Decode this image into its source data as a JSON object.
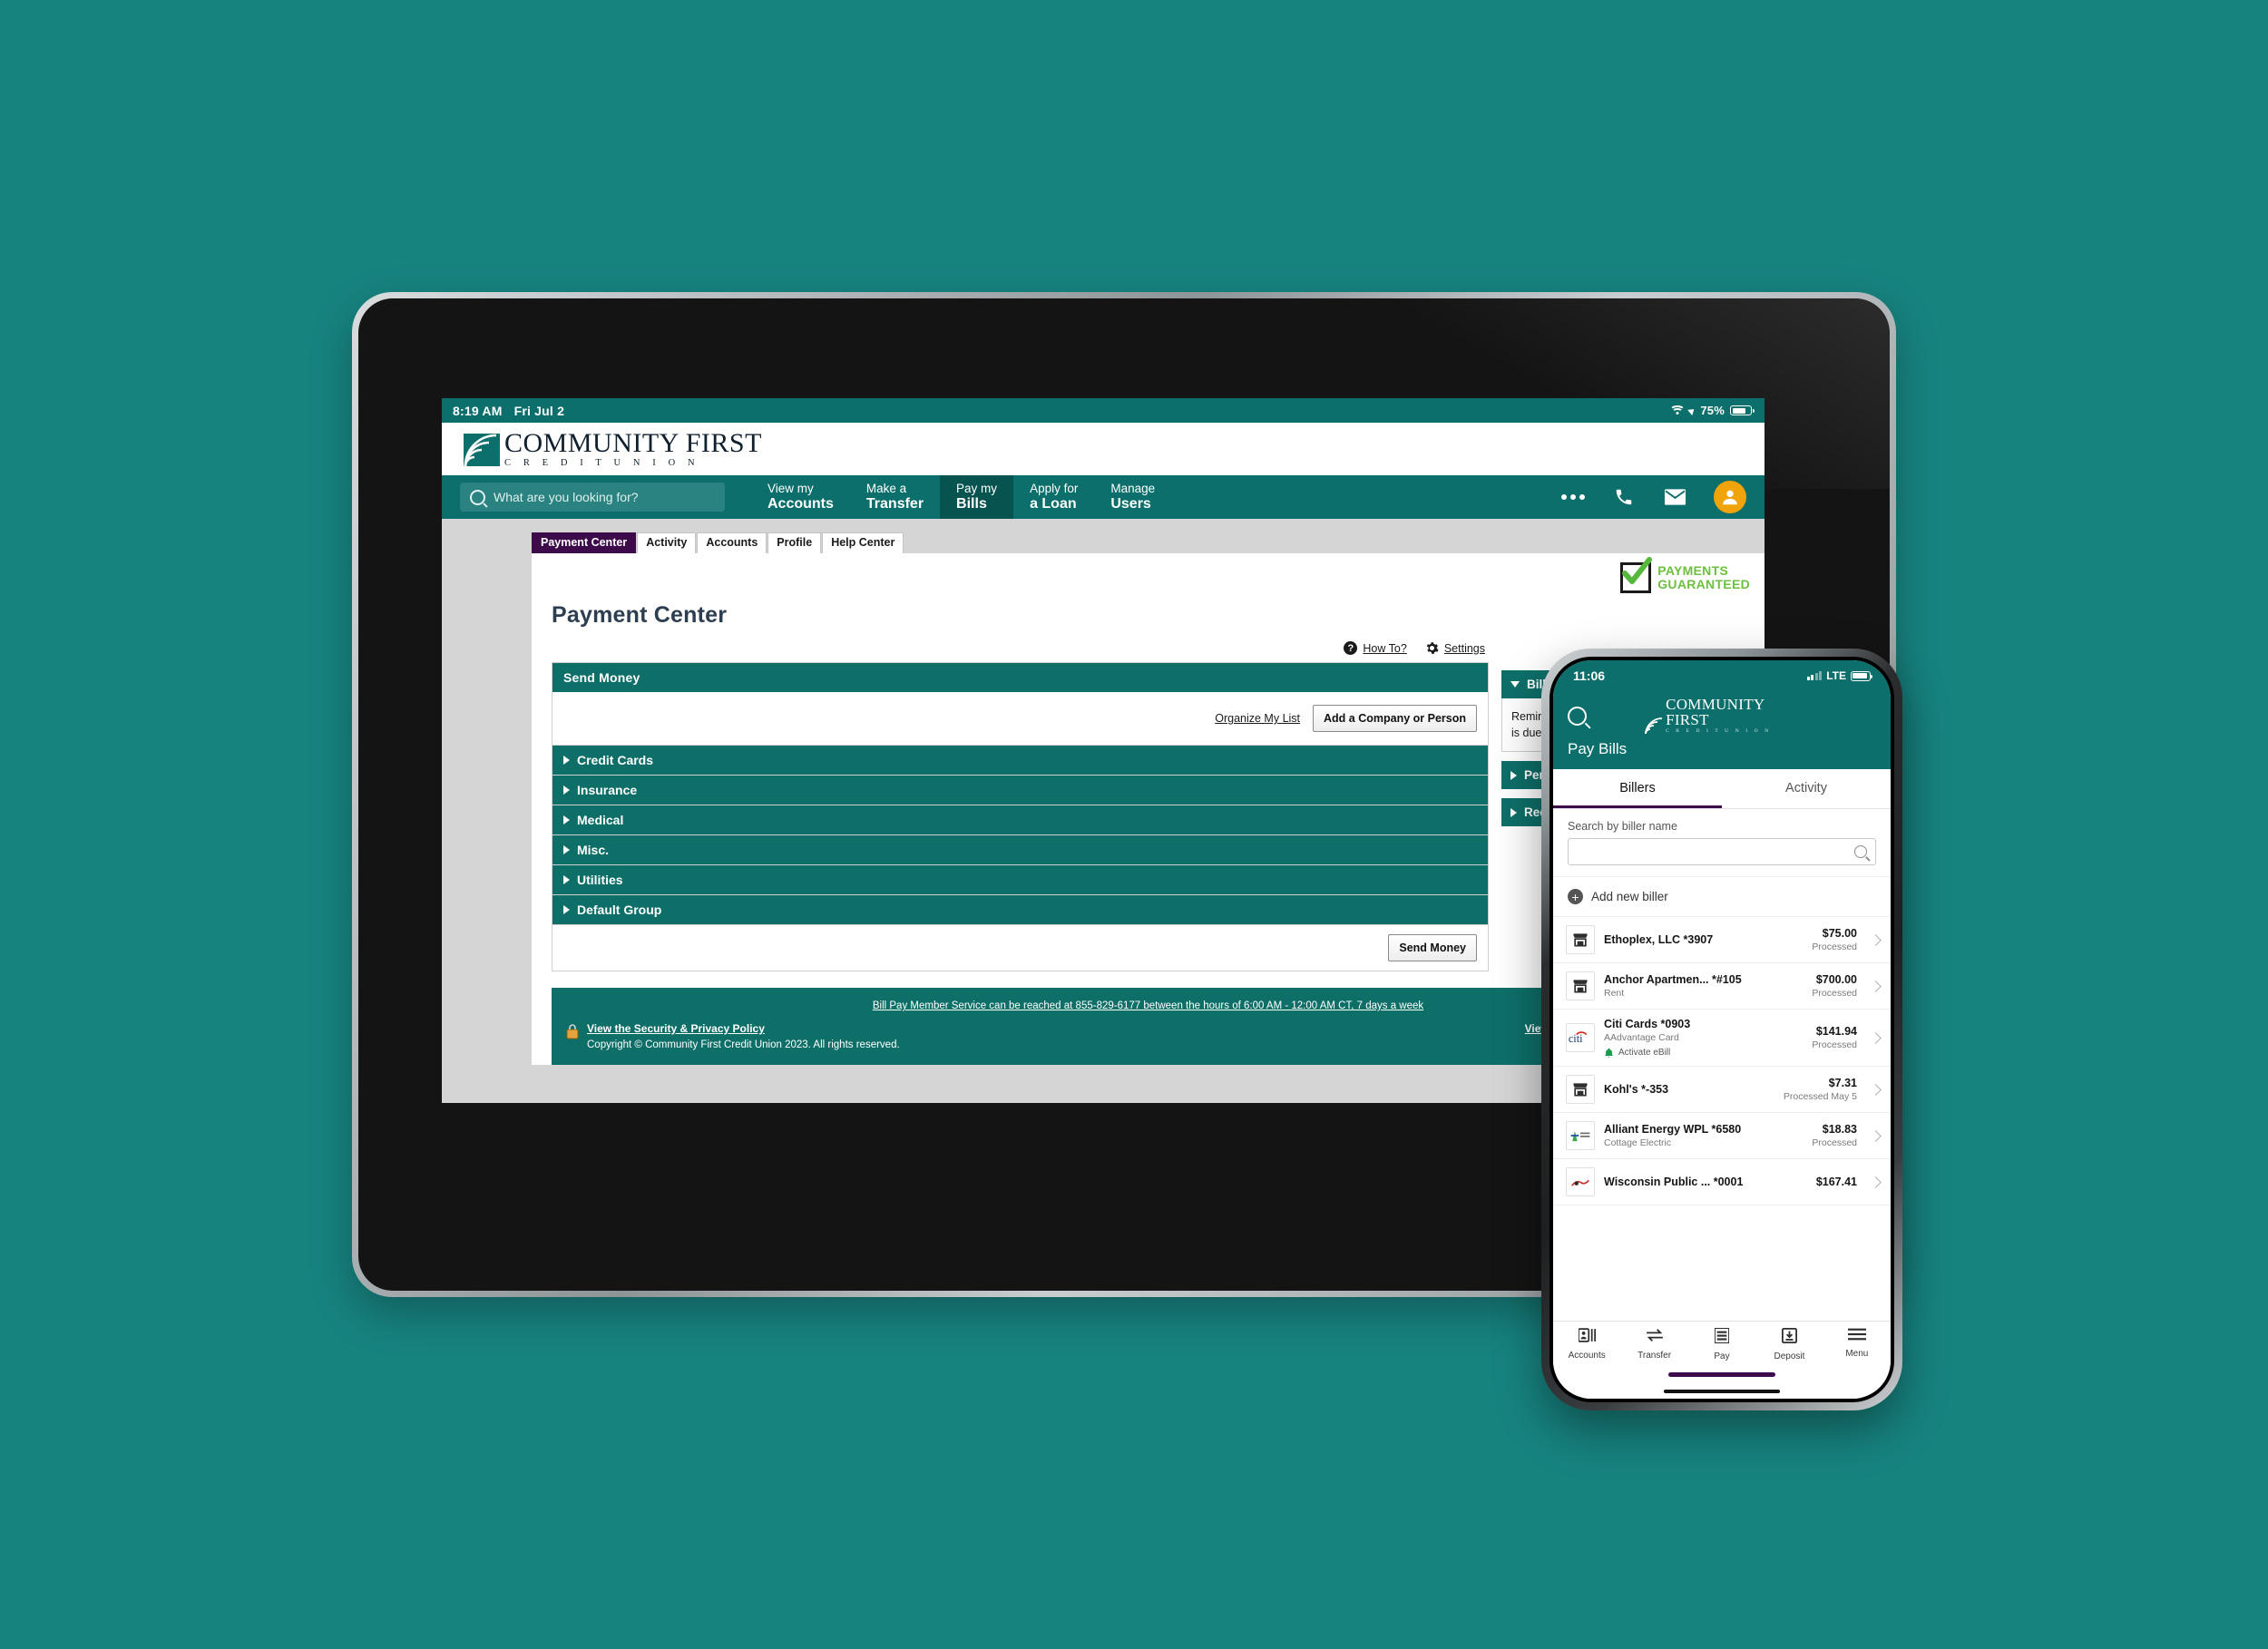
{
  "theme": {
    "background": "#17837f",
    "teal": "#0d6f6b",
    "teal_dark": "#075350",
    "panel_teal": "#0e6f69",
    "accent_purple": "#3d0b4a",
    "avatar_orange": "#f0a30a",
    "badge_green": "#6cbf3f"
  },
  "tablet": {
    "status_bar": {
      "time": "8:19 AM",
      "date": "Fri Jul 2",
      "battery": "75%",
      "wifi_icon": "wifi-icon",
      "location_icon": "location-arrow-icon",
      "battery_icon": "battery-icon"
    },
    "brand": {
      "name_main": "COMMUNITY FIRST",
      "name_sub": "C R E D I T   U N I O N",
      "logo_icon": "community-first-logo-icon"
    },
    "search": {
      "placeholder": "What are you looking for?",
      "value": "",
      "icon": "search-icon"
    },
    "nav": [
      {
        "line1": "View my",
        "line2": "Accounts",
        "active": false
      },
      {
        "line1": "Make a",
        "line2": "Transfer",
        "active": false
      },
      {
        "line1": "Pay my",
        "line2": "Bills",
        "active": true
      },
      {
        "line1": "Apply for",
        "line2": "a Loan",
        "active": false
      },
      {
        "line1": "Manage",
        "line2": "Users",
        "active": false
      }
    ],
    "nav_right": {
      "more_icon": "more-options-icon",
      "phone_icon": "phone-icon",
      "mail_icon": "mail-icon",
      "avatar_icon": "user-avatar-icon"
    },
    "tabs": [
      {
        "label": "Payment Center",
        "active": true
      },
      {
        "label": "Activity",
        "active": false
      },
      {
        "label": "Accounts",
        "active": false
      },
      {
        "label": "Profile",
        "active": false
      },
      {
        "label": "Help Center",
        "active": false
      }
    ],
    "guaranteed_badge": {
      "line1": "PAYMENTS",
      "line2": "GUARANTEED",
      "icon": "checkbox-check-icon"
    },
    "page_title": "Payment Center",
    "tool_links": [
      {
        "label": "How To?",
        "icon": "question-mark-icon"
      },
      {
        "label": "Settings",
        "icon": "gear-icon"
      }
    ],
    "send_money": {
      "header": "Send Money",
      "organize_link": "Organize My List",
      "add_button": "Add a Company or Person",
      "groups": [
        {
          "label": "Credit Cards"
        },
        {
          "label": "Insurance"
        },
        {
          "label": "Medical"
        },
        {
          "label": "Misc."
        },
        {
          "label": "Utilities"
        },
        {
          "label": "Default Group"
        }
      ],
      "send_button": "Send Money"
    },
    "sidebar_panels": [
      {
        "label": "Bills Due",
        "expanded": true,
        "body": "Reminders help you track when a payment is due."
      },
      {
        "label": "Pending Payments",
        "expanded": false,
        "body": ""
      },
      {
        "label": "Recent Payments",
        "expanded": false,
        "body": ""
      }
    ],
    "footer": {
      "top_line": "Bill Pay Member Service can be reached at 855-829-6177 between the hours of 6:00 AM - 12:00 AM CT, 7 days a week",
      "security_link": "View the Security & Privacy Policy",
      "copyright": "Copyright © Community First Credit Union 2023. All rights reserved.",
      "terms_link": "View the Terms & Conditions",
      "more_link": "View M",
      "lock_icon": "lock-icon"
    }
  },
  "phone": {
    "status_bar": {
      "time": "11:06",
      "network": "LTE",
      "signal_icon": "signal-bars-icon",
      "battery_icon": "battery-icon"
    },
    "brand": {
      "name_main": "COMMUNITY FIRST",
      "name_sub": "C R E D I T  U N I O N"
    },
    "search_icon": "search-icon",
    "title": "Pay Bills",
    "tabs": [
      {
        "label": "Billers",
        "active": true
      },
      {
        "label": "Activity",
        "active": false
      }
    ],
    "search": {
      "label": "Search by biller name",
      "value": "",
      "icon": "search-icon"
    },
    "add_biller": {
      "label": "Add new biller",
      "icon": "plus-circle-icon"
    },
    "billers": [
      {
        "name": "Ethoplex, LLC *3907",
        "sub": "",
        "amount": "$75.00",
        "status": "Processed",
        "icon": "storefront-icon",
        "ebill": ""
      },
      {
        "name": "Anchor Apartmen... *#105",
        "sub": "Rent",
        "amount": "$700.00",
        "status": "Processed",
        "icon": "storefront-icon",
        "ebill": ""
      },
      {
        "name": "Citi Cards *0903",
        "sub": "AAdvantage Card",
        "amount": "$141.94",
        "status": "Processed",
        "icon": "citi-logo-icon",
        "ebill": "Activate eBill"
      },
      {
        "name": "Kohl's *-353",
        "sub": "",
        "amount": "$7.31",
        "status": "Processed May 5",
        "icon": "storefront-icon",
        "ebill": ""
      },
      {
        "name": "Alliant Energy WPL *6580",
        "sub": "Cottage Electric",
        "amount": "$18.83",
        "status": "Processed",
        "icon": "alliant-energy-logo-icon",
        "ebill": ""
      },
      {
        "name": "Wisconsin Public ... *0001",
        "sub": "",
        "amount": "$167.41",
        "status": "",
        "icon": "wisconsin-public-logo-icon",
        "ebill": ""
      }
    ],
    "tabbar": [
      {
        "label": "Accounts",
        "icon": "accounts-icon",
        "active": false
      },
      {
        "label": "Transfer",
        "icon": "transfer-arrows-icon",
        "active": false
      },
      {
        "label": "Pay",
        "icon": "pay-icon",
        "active": true
      },
      {
        "label": "Deposit",
        "icon": "deposit-icon",
        "active": false
      },
      {
        "label": "Menu",
        "icon": "hamburger-menu-icon",
        "active": false
      }
    ]
  }
}
